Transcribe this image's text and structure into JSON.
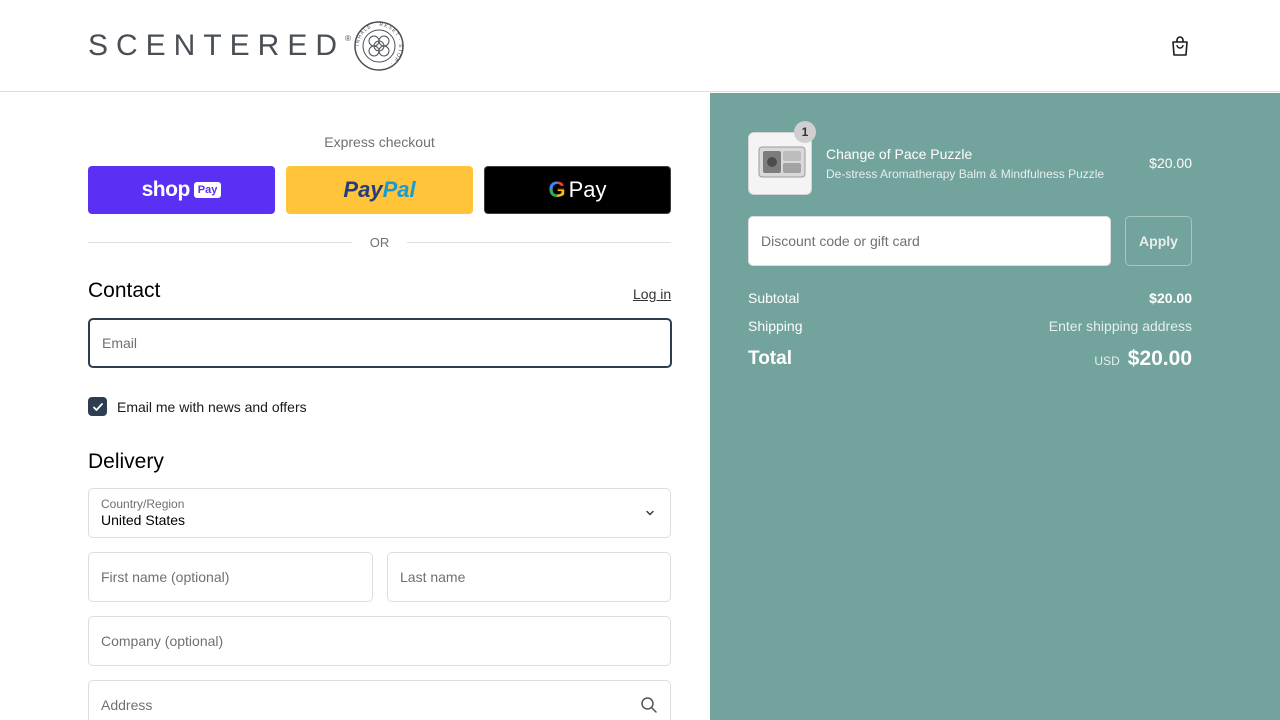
{
  "header": {
    "brand": "SCENTERED",
    "seal_text": "INHALE · RESET · STOP ·"
  },
  "express": {
    "label": "Express checkout",
    "shop_pay": {
      "text": "shop",
      "badge": "Pay"
    },
    "paypal": {
      "part1": "Pay",
      "part2": "Pal"
    },
    "gpay": {
      "g": "G",
      "text": "Pay"
    },
    "or": "OR"
  },
  "contact": {
    "title": "Contact",
    "login": "Log in",
    "email_placeholder": "Email",
    "newsletter_label": "Email me with news and offers",
    "newsletter_checked": true
  },
  "delivery": {
    "title": "Delivery",
    "country_label": "Country/Region",
    "country_value": "United States",
    "first_name_placeholder": "First name (optional)",
    "last_name_placeholder": "Last name",
    "company_placeholder": "Company (optional)",
    "address_placeholder": "Address"
  },
  "summary": {
    "product": {
      "quantity": "1",
      "name": "Change of Pace Puzzle",
      "description": "De-stress Aromatherapy Balm & Mindfulness Puzzle",
      "price": "$20.00"
    },
    "discount_placeholder": "Discount code or gift card",
    "apply_label": "Apply",
    "subtotal_label": "Subtotal",
    "subtotal_value": "$20.00",
    "shipping_label": "Shipping",
    "shipping_value": "Enter shipping address",
    "total_label": "Total",
    "currency": "USD",
    "total_value": "$20.00"
  },
  "colors": {
    "summary_bg": "#72a39c",
    "shop_pay": "#5a31f4",
    "paypal": "#ffc439",
    "checkbox": "#2c3e50"
  }
}
